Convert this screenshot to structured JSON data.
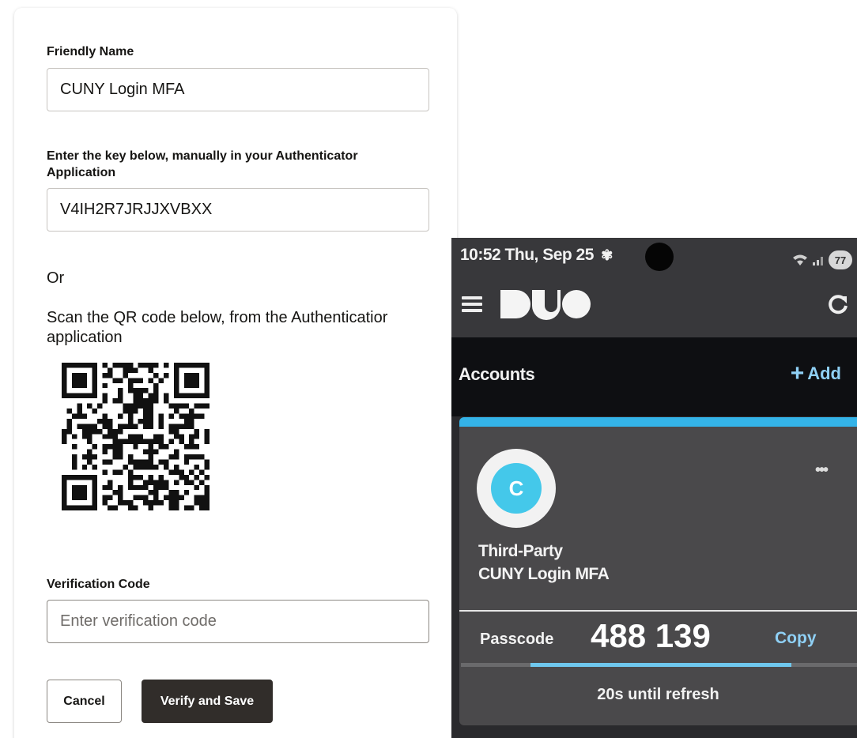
{
  "form": {
    "friendly_name_label": "Friendly Name",
    "friendly_name_value": "CUNY Login MFA",
    "manual_key_label_line1": "Enter the key below, manually in your Authenticator",
    "manual_key_label_line2": "Application",
    "manual_key_value": "V4IH2R7JRJJXVBXX",
    "or_text": "Or",
    "scan_text_line1": "Scan the QR code below, from the Authenticatior",
    "scan_text_line2": "application",
    "verification_label": "Verification Code",
    "verification_placeholder": "Enter verification code",
    "verification_value": "",
    "cancel_label": "Cancel",
    "verify_label": "Verify and Save"
  },
  "phone": {
    "status_time": "10:52 Thu, Sep 25",
    "battery_level": "77",
    "app_name": "DUO",
    "accounts_label": "Accounts",
    "add_label": "Add",
    "account": {
      "avatar_letter": "C",
      "type": "Third-Party",
      "name": "CUNY Login MFA"
    },
    "passcode_label": "Passcode",
    "passcode_value": "488 139",
    "copy_label": "Copy",
    "refresh_text": "20s until refresh",
    "refresh_progress": 0.66
  },
  "colors": {
    "primary_button": "#312d2a",
    "duo_accent": "#34b3e8",
    "duo_link": "#8fd0f5"
  }
}
